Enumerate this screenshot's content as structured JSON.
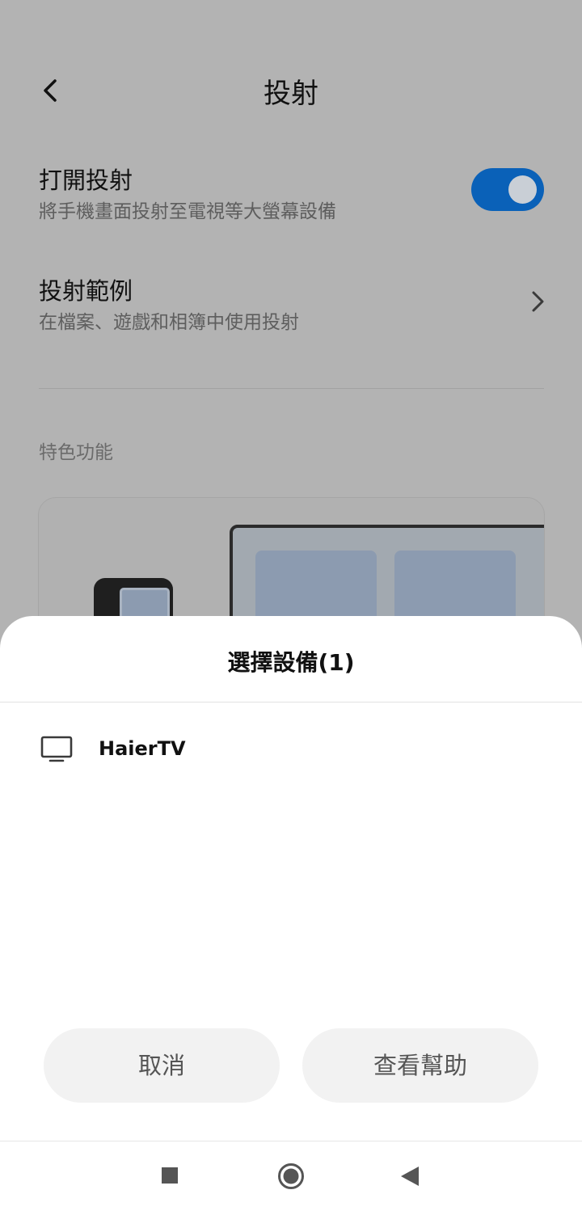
{
  "header": {
    "title": "投射"
  },
  "settings": {
    "open_cast": {
      "title": "打開投射",
      "subtitle": "將手機畫面投射至電視等大螢幕設備",
      "enabled": true
    },
    "cast_examples": {
      "title": "投射範例",
      "subtitle": "在檔案、遊戲和相簿中使用投射"
    },
    "section_label": "特色功能"
  },
  "sheet": {
    "title": "選擇設備(1)",
    "devices": [
      {
        "name": "HaierTV",
        "icon": "tv-icon"
      }
    ],
    "cancel_label": "取消",
    "help_label": "查看幫助"
  },
  "colors": {
    "accent": "#0a61b8",
    "overlay": "#b3b3b3",
    "sheet_bg": "#ffffff",
    "button_bg": "#f2f2f2"
  },
  "navbar": {
    "icons": [
      "recents-square-icon",
      "home-circle-icon",
      "back-triangle-icon"
    ]
  }
}
